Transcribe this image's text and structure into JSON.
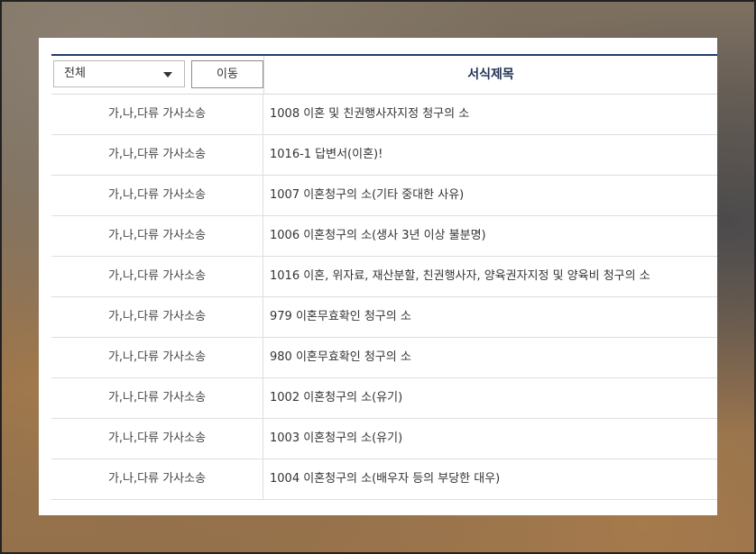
{
  "toolbar": {
    "select_value": "전체",
    "move_label": "이동"
  },
  "table": {
    "title_header": "서식제목",
    "rows": [
      {
        "category": "가,나,다류 가사소송",
        "title": "1008 이혼 및 친권행사자지정 청구의 소"
      },
      {
        "category": "가,나,다류 가사소송",
        "title": "1016-1 답변서(이혼)!"
      },
      {
        "category": "가,나,다류 가사소송",
        "title": "1007 이혼청구의 소(기타 중대한 사유)"
      },
      {
        "category": "가,나,다류 가사소송",
        "title": "1006 이혼청구의 소(생사 3년 이상 불분명)"
      },
      {
        "category": "가,나,다류 가사소송",
        "title": "1016 이혼, 위자료, 재산분할, 친권행사자, 양육권자지정 및 양육비 청구의 소"
      },
      {
        "category": "가,나,다류 가사소송",
        "title": "979 이혼무효확인 청구의 소"
      },
      {
        "category": "가,나,다류 가사소송",
        "title": "980 이혼무효확인 청구의 소"
      },
      {
        "category": "가,나,다류 가사소송",
        "title": "1002 이혼청구의 소(유기)"
      },
      {
        "category": "가,나,다류 가사소송",
        "title": "1003 이혼청구의 소(유기)"
      },
      {
        "category": "가,나,다류 가사소송",
        "title": "1004 이혼청구의 소(배우자 등의 부당한 대우)"
      }
    ]
  }
}
